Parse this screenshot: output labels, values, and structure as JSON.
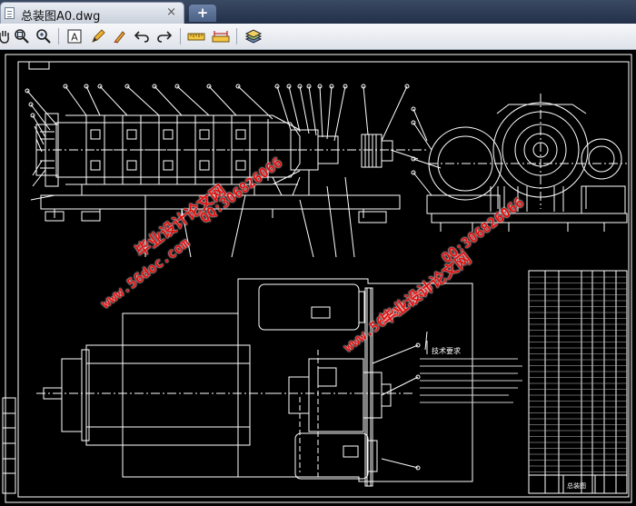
{
  "tab": {
    "title": "总装图A0.dwg",
    "close": "×"
  },
  "new_tab": "+",
  "toolbar": {
    "icons": [
      "pan-hand-icon",
      "zoom-window-icon",
      "zoom-extents-icon",
      "text-icon",
      "pencil-icon",
      "brush-icon",
      "undo-icon",
      "redo-icon",
      "measure-ruler-icon",
      "measure-area-icon",
      "layers-icon"
    ]
  },
  "drawing": {
    "notes_title": "技术要求",
    "bom_title": "总装图"
  },
  "watermarks": {
    "site": "www.56doc.com",
    "brand": "毕业设计论文网",
    "qq": "QQ:306826066"
  },
  "colors": {
    "line": "#ffffff",
    "dim": "#e8e8e8",
    "watermark": "#e01010"
  }
}
